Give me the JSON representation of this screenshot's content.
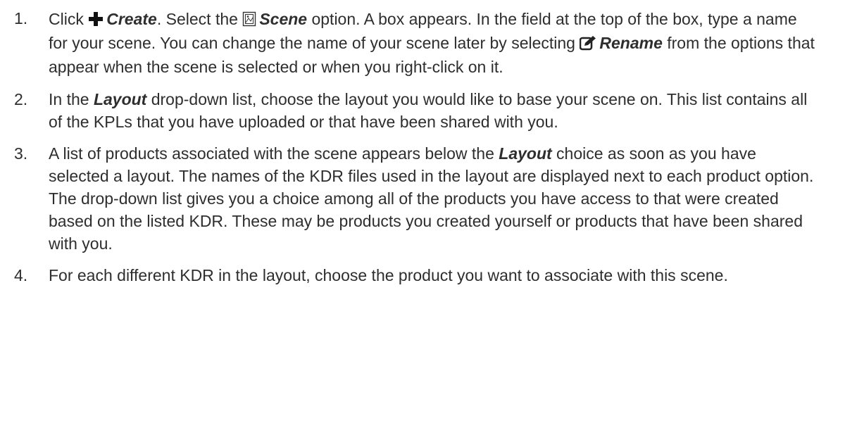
{
  "steps": [
    {
      "number": "1.",
      "parts": {
        "t1": "Click ",
        "create_icon": "plus-icon",
        "create_label": "Create",
        "t2": ". Select the ",
        "scene_icon": "scene-icon",
        "scene_label": "Scene",
        "t3": " option. A box appears. In the field at the top of the box, type a name for your scene. You can change the name of your scene later by selecting ",
        "rename_icon": "edit-icon",
        "rename_label": "Rename",
        "t4": " from the options that appear when the scene is selected or when you right-click on it."
      }
    },
    {
      "number": "2.",
      "parts": {
        "t1": "In the ",
        "layout_label": "Layout",
        "t2": " drop-down list, choose the layout you would like to base your scene on. This list contains all of the KPLs that you have uploaded or that have been shared with you."
      }
    },
    {
      "number": "3.",
      "parts": {
        "t1": "A list of products associated with the scene appears below the ",
        "layout_label": "Layout",
        "t2": " choice as soon as you have selected a layout. The names of the KDR files used in the layout are displayed next to each product option. The drop-down list gives you a choice among all of the products you have access to that were created based on the listed KDR. These may be products you created yourself or products that have been shared with you."
      }
    },
    {
      "number": "4.",
      "parts": {
        "t1": "For each different KDR in the layout, choose the product you want to associate with this scene."
      }
    }
  ]
}
